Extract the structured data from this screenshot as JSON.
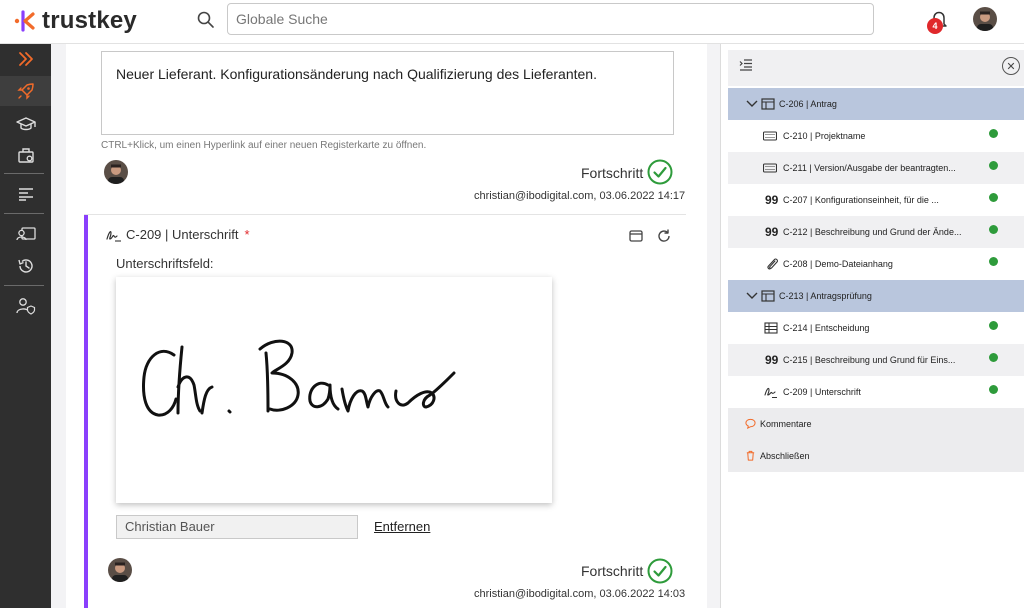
{
  "header": {
    "brand": "trustkey",
    "search_placeholder": "Globale Suche",
    "notification_count": "4"
  },
  "nav": {
    "icons": [
      "expand-icon",
      "rocket-icon",
      "graduation-cap-icon",
      "briefcase-icon",
      "list-icon",
      "id-card-icon",
      "history-icon",
      "user-shield-icon"
    ]
  },
  "main": {
    "description": "Neuer Lieferant. Konfigurationsänderung nach Qualifizierung des Lieferanten.",
    "hint": "CTRL+Klick, um einen Hyperlink auf einer neuen Registerkarte zu öffnen.",
    "progress_label": "Fortschritt",
    "entry1_meta": "christian@ibodigital.com, 03.06.2022 14:17",
    "card_title": "C-209 | Unterschrift",
    "required_mark": "*",
    "sig_field_label": "Unterschriftsfeld:",
    "signer_name": "Christian Bauer",
    "remove_label": "Entfernen",
    "entry2_meta": "christian@ibodigital.com, 03.06.2022 14:03"
  },
  "tree": {
    "items": [
      {
        "label": "C-206 | Antrag",
        "type": "section",
        "icon": "table-icon"
      },
      {
        "label": "C-210 | Projektname",
        "type": "item",
        "icon": "keyboard-icon",
        "done": true
      },
      {
        "label": "C-211 | Version/Ausgabe der beantragten...",
        "type": "item",
        "icon": "keyboard-icon",
        "done": true
      },
      {
        "label": "C-207 | Konfigurationseinheit, für die ...",
        "type": "item",
        "icon": "quote-icon",
        "done": true
      },
      {
        "label": "C-212 | Beschreibung und Grund der Ände...",
        "type": "item",
        "icon": "quote-icon",
        "done": true
      },
      {
        "label": "C-208 | Demo-Dateianhang",
        "type": "item",
        "icon": "paperclip-icon",
        "done": true
      },
      {
        "label": "C-213 | Antragsprüfung",
        "type": "section",
        "icon": "table-icon"
      },
      {
        "label": "C-214 | Entscheidung",
        "type": "item",
        "icon": "grid-icon",
        "done": true
      },
      {
        "label": "C-215 | Beschreibung und Grund für Eins...",
        "type": "item",
        "icon": "quote-icon",
        "done": true
      },
      {
        "label": "C-209 | Unterschrift",
        "type": "item",
        "icon": "signature-icon",
        "done": true
      }
    ],
    "comments_label": "Kommentare",
    "finish_label": "Abschließen"
  },
  "colors": {
    "accent_orange": "#f26b2a",
    "accent_purple": "#8a3ffc",
    "success_green": "#2e9b3b",
    "section_blue": "#b9c6dd",
    "badge_red": "#e0282b"
  }
}
